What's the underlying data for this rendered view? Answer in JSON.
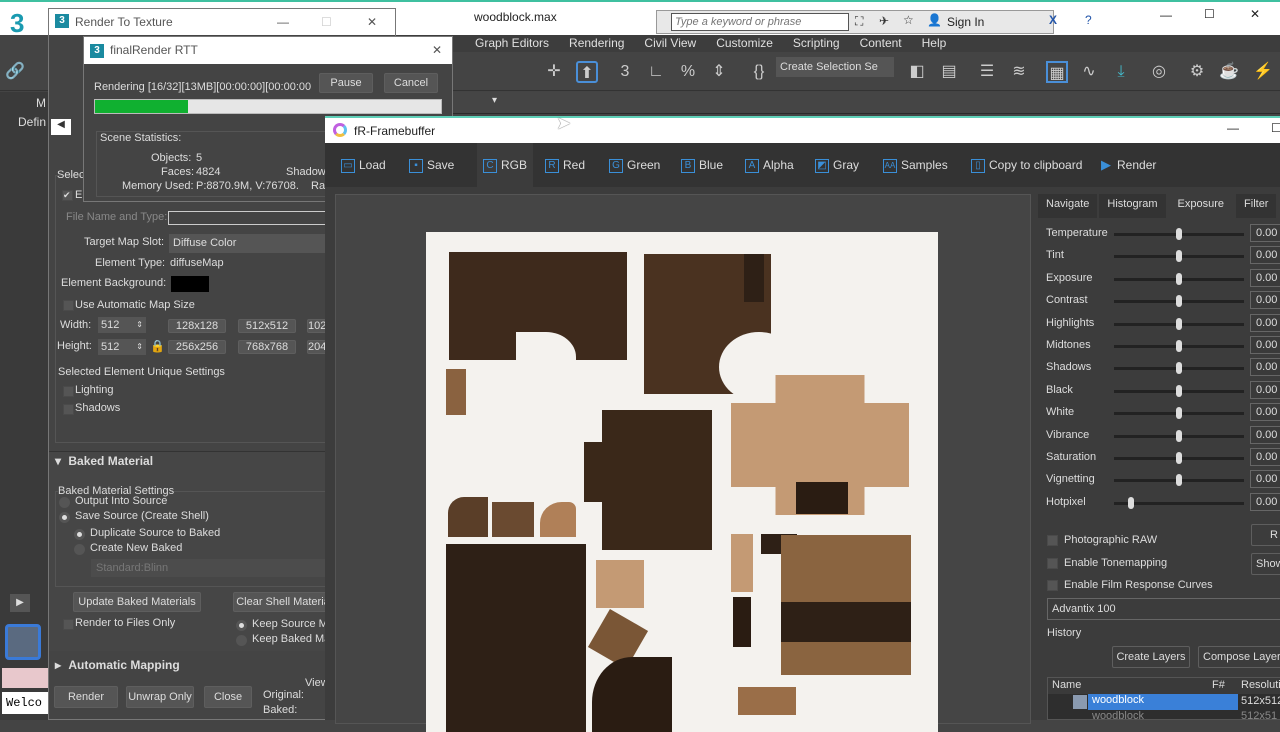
{
  "app": {
    "file_title": "woodblock.max",
    "search_placeholder": "Type a keyword or phrase",
    "sign_in": "Sign In",
    "menu": [
      "Graph Editors",
      "Rendering",
      "Civil View",
      "Customize",
      "Scripting",
      "Content",
      "Help"
    ],
    "selection_set": "Create Selection Se",
    "left_tabs": [
      "M",
      "Defin"
    ],
    "welcome": "Welco"
  },
  "rtt": {
    "title": "Render To Texture",
    "selected_group": "Selec",
    "enable": "E",
    "file_name_label": "File Name and Type:",
    "target_map_slot_label": "Target Map Slot:",
    "target_map_slot": "Diffuse Color",
    "element_type_label": "Element Type:",
    "element_type": "diffuseMap",
    "element_bg_label": "Element Background:",
    "auto_map_size": "Use Automatic Map Size",
    "width_label": "Width:",
    "width": "512",
    "height_label": "Height:",
    "height": "512",
    "sizes": [
      "128x128",
      "512x512",
      "102",
      "256x256",
      "768x768",
      "204"
    ],
    "unique_settings": "Selected Element Unique Settings",
    "lighting": "Lighting",
    "shadows": "Shadows",
    "baked_material": "Baked Material",
    "baked_settings": "Baked Material Settings",
    "output_into_source": "Output Into Source",
    "save_source": "Save Source (Create Shell)",
    "duplicate": "Duplicate Source to Baked",
    "create_new": "Create New Baked",
    "material_type": "Standard:Blinn",
    "update_baked": "Update Baked Materials",
    "clear_shell": "Clear Shell Materia",
    "render_files_only": "Render to Files Only",
    "keep_source": "Keep Source M",
    "keep_baked": "Keep Baked Ma",
    "auto_mapping": "Automatic Mapping",
    "render": "Render",
    "unwrap_only": "Unwrap Only",
    "close": "Close",
    "views": "View",
    "original": "Original:",
    "baked": "Baked:"
  },
  "frtt": {
    "title": "finalRender RTT",
    "status": "Rendering [16/32][13MB][00:00:00][00:00:00",
    "progress": 0.27,
    "pause": "Pause",
    "cancel": "Cancel",
    "scene_stats": "Scene Statistics:",
    "objects_label": "Objects:",
    "objects": "5",
    "faces_label": "Faces:",
    "faces": "4824",
    "memory_label": "Memory Used:",
    "memory": "P:8870.9M, V:76708.",
    "shadow": "Shadow",
    "ra": "Ra"
  },
  "fb": {
    "title": "fR-Framebuffer",
    "toolbar": [
      {
        "icon": "folder",
        "label": "Load"
      },
      {
        "icon": "disk",
        "label": "Save"
      },
      {
        "icon": "C",
        "label": "RGB"
      },
      {
        "icon": "R",
        "label": "Red"
      },
      {
        "icon": "G",
        "label": "Green"
      },
      {
        "icon": "B",
        "label": "Blue"
      },
      {
        "icon": "A",
        "label": "Alpha"
      },
      {
        "icon": "gray",
        "label": "Gray"
      },
      {
        "icon": "AA",
        "label": "Samples"
      },
      {
        "icon": "clipboard",
        "label": "Copy to clipboard"
      },
      {
        "icon": "play",
        "label": "Render"
      }
    ],
    "tabs": [
      "Navigate",
      "Histogram",
      "Exposure",
      "Filter"
    ],
    "active_tab": "Exposure",
    "exposure": [
      {
        "name": "Temperature",
        "value": "0.00",
        "pos": 0.5
      },
      {
        "name": "Tint",
        "value": "0.00",
        "pos": 0.5
      },
      {
        "name": "Exposure",
        "value": "0.00",
        "pos": 0.5
      },
      {
        "name": "Contrast",
        "value": "0.00",
        "pos": 0.5
      },
      {
        "name": "Highlights",
        "value": "0.00",
        "pos": 0.5
      },
      {
        "name": "Midtones",
        "value": "0.00",
        "pos": 0.5
      },
      {
        "name": "Shadows",
        "value": "0.00",
        "pos": 0.5
      },
      {
        "name": "Black",
        "value": "0.00",
        "pos": 0.5
      },
      {
        "name": "White",
        "value": "0.00",
        "pos": 0.5
      },
      {
        "name": "Vibrance",
        "value": "0.00",
        "pos": 0.5
      },
      {
        "name": "Saturation",
        "value": "0.00",
        "pos": 0.5
      },
      {
        "name": "Vignetting",
        "value": "0.00",
        "pos": 0.5
      },
      {
        "name": "Hotpixel",
        "value": "0.00",
        "pos": 0.13
      }
    ],
    "photographic_raw": "Photographic RAW",
    "tonemapping": "Enable Tonemapping",
    "film_curves": "Enable Film Response Curves",
    "r_btn": "R",
    "show_btn": "Show",
    "film": "Advantix 100",
    "history": "History",
    "create_layers": "Create Layers",
    "compose_layers": "Compose Layers",
    "cols": [
      "Name",
      "F#",
      "Resoluti"
    ],
    "rows": [
      {
        "name": "woodblock",
        "res": "512x512"
      },
      {
        "name": "woodblock",
        "res": "512x51"
      }
    ]
  }
}
